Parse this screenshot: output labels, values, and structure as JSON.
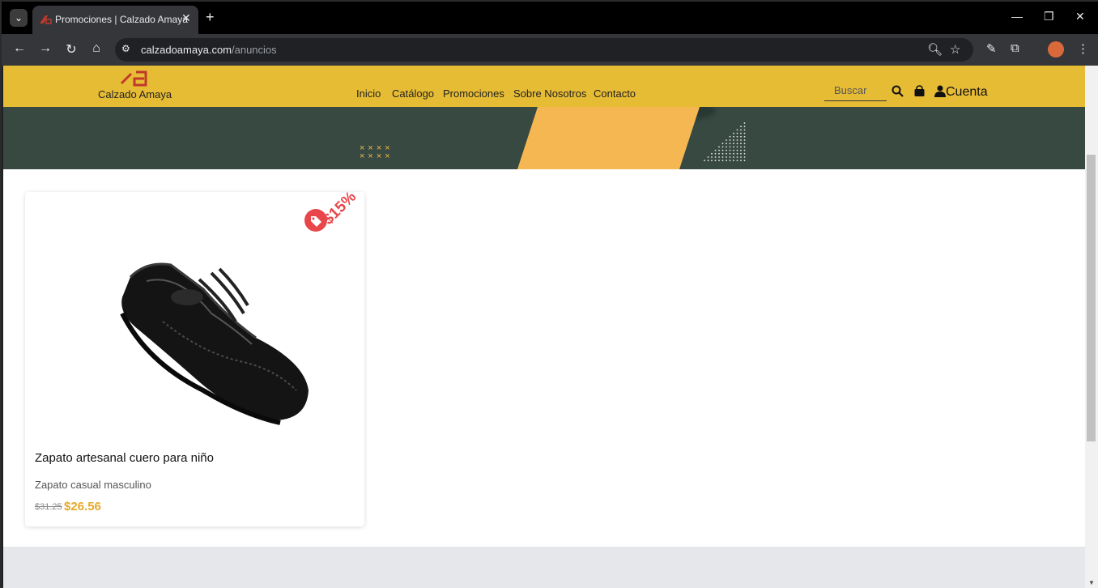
{
  "browser": {
    "tab_title": "Promociones | Calzado Amaya",
    "url_domain": "calzadoamaya.com",
    "url_path": "/anuncios",
    "tab_menu_icon": "chevron-down-icon",
    "new_tab_icon": "plus-icon"
  },
  "site": {
    "logo_text": "Calzado Amaya",
    "nav": [
      "Inicio",
      "Catálogo",
      "Promociones",
      "Sobre Nosotros",
      "Contacto"
    ],
    "search_placeholder": "Buscar",
    "account_label": "Cuenta",
    "brand_color": "#e7bc35",
    "banner_color": "#384942"
  },
  "product": {
    "name": "Zapato artesanal cuero para niño",
    "category": "Zapato casual masculino",
    "old_price": "$31.25",
    "new_price": "$26.56",
    "discount": "$15%",
    "discount_color": "#e8464a",
    "price_color": "#e7a928"
  }
}
